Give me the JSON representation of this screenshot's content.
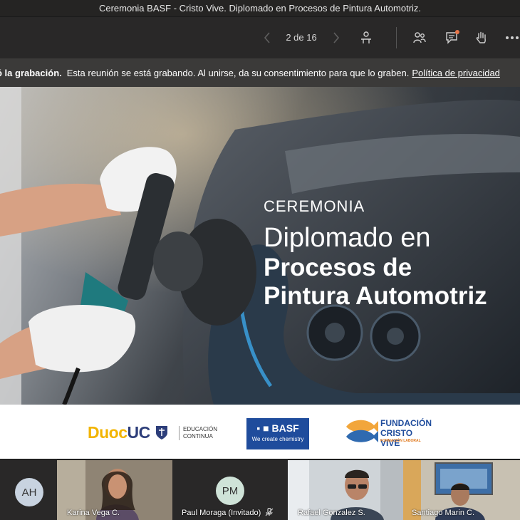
{
  "window": {
    "title": "Ceremonia BASF - Cristo Vive. Diplomado en Procesos de Pintura Automotriz."
  },
  "toolbar": {
    "page_counter": "2 de 16"
  },
  "banner": {
    "strong_text": "ó la grabación.",
    "message": "Esta reunión se está grabando. Al unirse, da su consentimiento para que lo graben.",
    "link_text": "Política de privacidad"
  },
  "slide": {
    "kicker": "CEREMONIA",
    "line1": "Diplomado en",
    "line2": "Procesos de",
    "line3": "Pintura Automotriz"
  },
  "logos": {
    "duoc_part1": "Duoc",
    "duoc_part2": "UC",
    "duoc_sub1": "EDUCACIÓN",
    "duoc_sub2": "CONTINUA",
    "basf_name": "BASF",
    "basf_tagline": "We create chemistry",
    "fcv_title": "FUNDACIÓN CRISTO VIVE",
    "fcv_sub": "FORMACIÓN LABORAL"
  },
  "participants": [
    {
      "initials": "AH",
      "name": ""
    },
    {
      "initials": "",
      "name": "Karina Vega C."
    },
    {
      "initials": "PM",
      "name": "Paul Moraga (Invitado)"
    },
    {
      "initials": "",
      "name": "Rafael Gonzalez S."
    },
    {
      "initials": "",
      "name": "Santiago Marin C."
    }
  ],
  "colors": {
    "banner_bg": "#3b3a39",
    "basf_blue": "#1f4c9c",
    "duoc_yellow": "#f2b400",
    "badge_orange": "#e97548"
  }
}
